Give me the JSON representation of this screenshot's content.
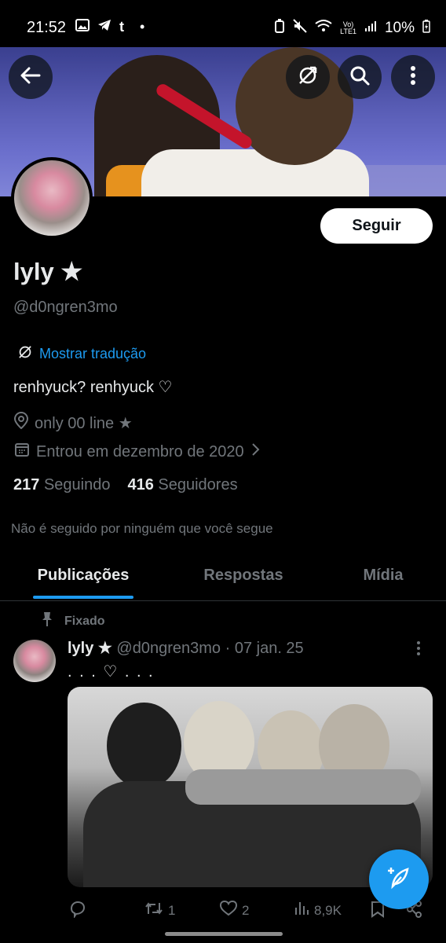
{
  "status_bar": {
    "time": "21:52",
    "battery": "10%"
  },
  "profile": {
    "name": "lyly ★",
    "handle": "@d0ngren3mo",
    "follow_label": "Seguir",
    "translate_label": "Mostrar tradução",
    "bio": "renhyuck? renhyuck ♡",
    "location": "only 00 line ★",
    "joined": "Entrou em dezembro de 2020",
    "following_count": "217",
    "following_label": "Seguindo",
    "followers_count": "416",
    "followers_label": "Seguidores",
    "not_followed_note": "Não é seguido por ninguém que você segue"
  },
  "tabs": [
    {
      "label": "Publicações",
      "active": true
    },
    {
      "label": "Respostas",
      "active": false
    },
    {
      "label": "Mídia",
      "active": false
    }
  ],
  "post": {
    "pinned_label": "Fixado",
    "author_name": "lyly ★",
    "author_handle": "@d0ngren3mo",
    "separator": "·",
    "date": "07 jan. 25",
    "text": ". . . ♡ . . .",
    "replies": "",
    "reposts": "1",
    "likes": "2",
    "views": "8,9K"
  },
  "colors": {
    "accent": "#1d9bf0",
    "background": "#000000",
    "muted": "#71767b"
  }
}
